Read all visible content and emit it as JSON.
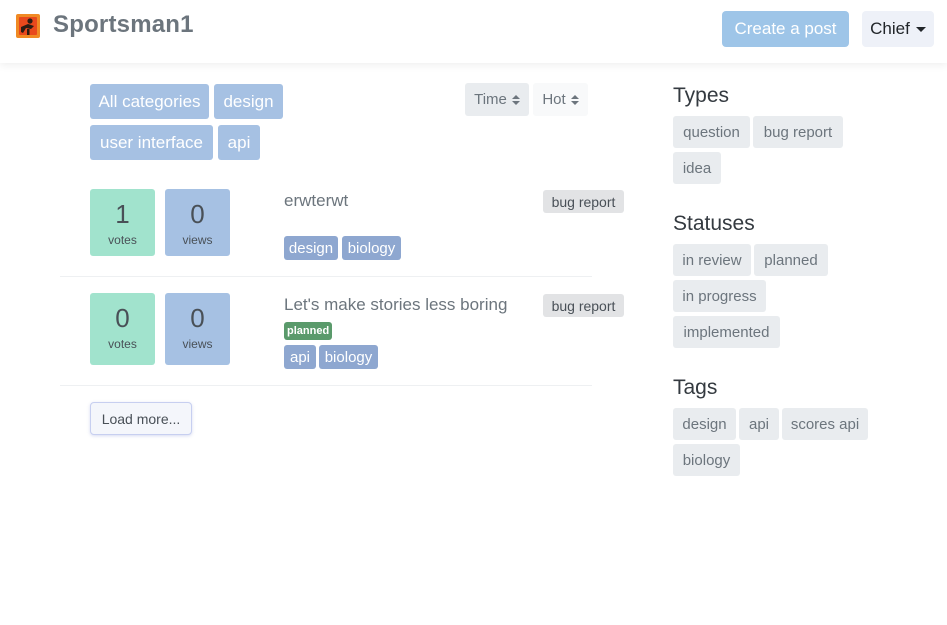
{
  "header": {
    "brand": "Sportsman1",
    "create_label": "Create a post",
    "user_label": "Chief"
  },
  "categories": [
    "All categories",
    "design",
    "user interface",
    "api"
  ],
  "sort": {
    "time": "Time",
    "hot": "Hot"
  },
  "posts": [
    {
      "votes": "1",
      "votes_label": "votes",
      "views": "0",
      "views_label": "views",
      "title": "erwterwt",
      "type": "bug report",
      "status": "",
      "tags": [
        "design",
        "biology"
      ]
    },
    {
      "votes": "0",
      "votes_label": "votes",
      "views": "0",
      "views_label": "views",
      "title": "Let's make stories less boring",
      "type": "bug report",
      "status": "planned",
      "tags": [
        "api",
        "biology"
      ]
    }
  ],
  "load_more": "Load more...",
  "sidebar": {
    "types_heading": "Types",
    "types": [
      "question",
      "bug report",
      "idea"
    ],
    "statuses_heading": "Statuses",
    "statuses": [
      "in review",
      "planned",
      "in progress",
      "implemented"
    ],
    "tags_heading": "Tags",
    "tags": [
      "design",
      "api",
      "scores api",
      "biology"
    ]
  },
  "colors": {
    "votes_bg": "#a1e3cd",
    "views_bg": "#a6c1e3",
    "category_bg": "#a6c1e3",
    "planned_badge": "#5a9a6b",
    "create_button": "#9ec5e8"
  }
}
